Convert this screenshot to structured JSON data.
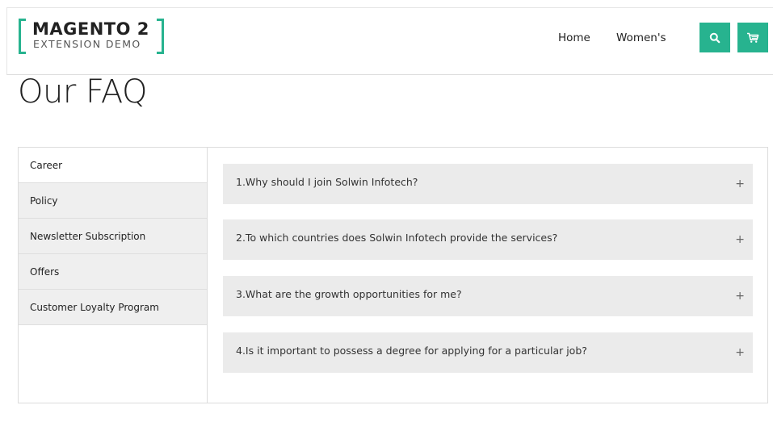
{
  "header": {
    "logo": {
      "line1": "MAGENTO 2",
      "line2": "EXTENSION DEMO"
    },
    "nav": [
      {
        "label": "Home"
      },
      {
        "label": "Women's"
      }
    ],
    "search_icon": "search-icon",
    "cart_icon": "cart-icon",
    "accent_color": "#27b38f"
  },
  "page": {
    "title": "Our FAQ"
  },
  "faq": {
    "categories": [
      {
        "label": "Career",
        "active": true
      },
      {
        "label": "Policy",
        "active": false
      },
      {
        "label": "Newsletter Subscription",
        "active": false
      },
      {
        "label": "Offers",
        "active": false
      },
      {
        "label": "Customer Loyalty Program",
        "active": false
      }
    ],
    "questions": [
      {
        "text": "1.Why should I join Solwin Infotech?",
        "toggle": "+"
      },
      {
        "text": "2.To which countries does Solwin Infotech provide the services?",
        "toggle": "+"
      },
      {
        "text": "3.What are the growth opportunities for me?",
        "toggle": "+"
      },
      {
        "text": "4.Is it important to possess a degree for applying for a particular job?",
        "toggle": "+"
      }
    ]
  }
}
